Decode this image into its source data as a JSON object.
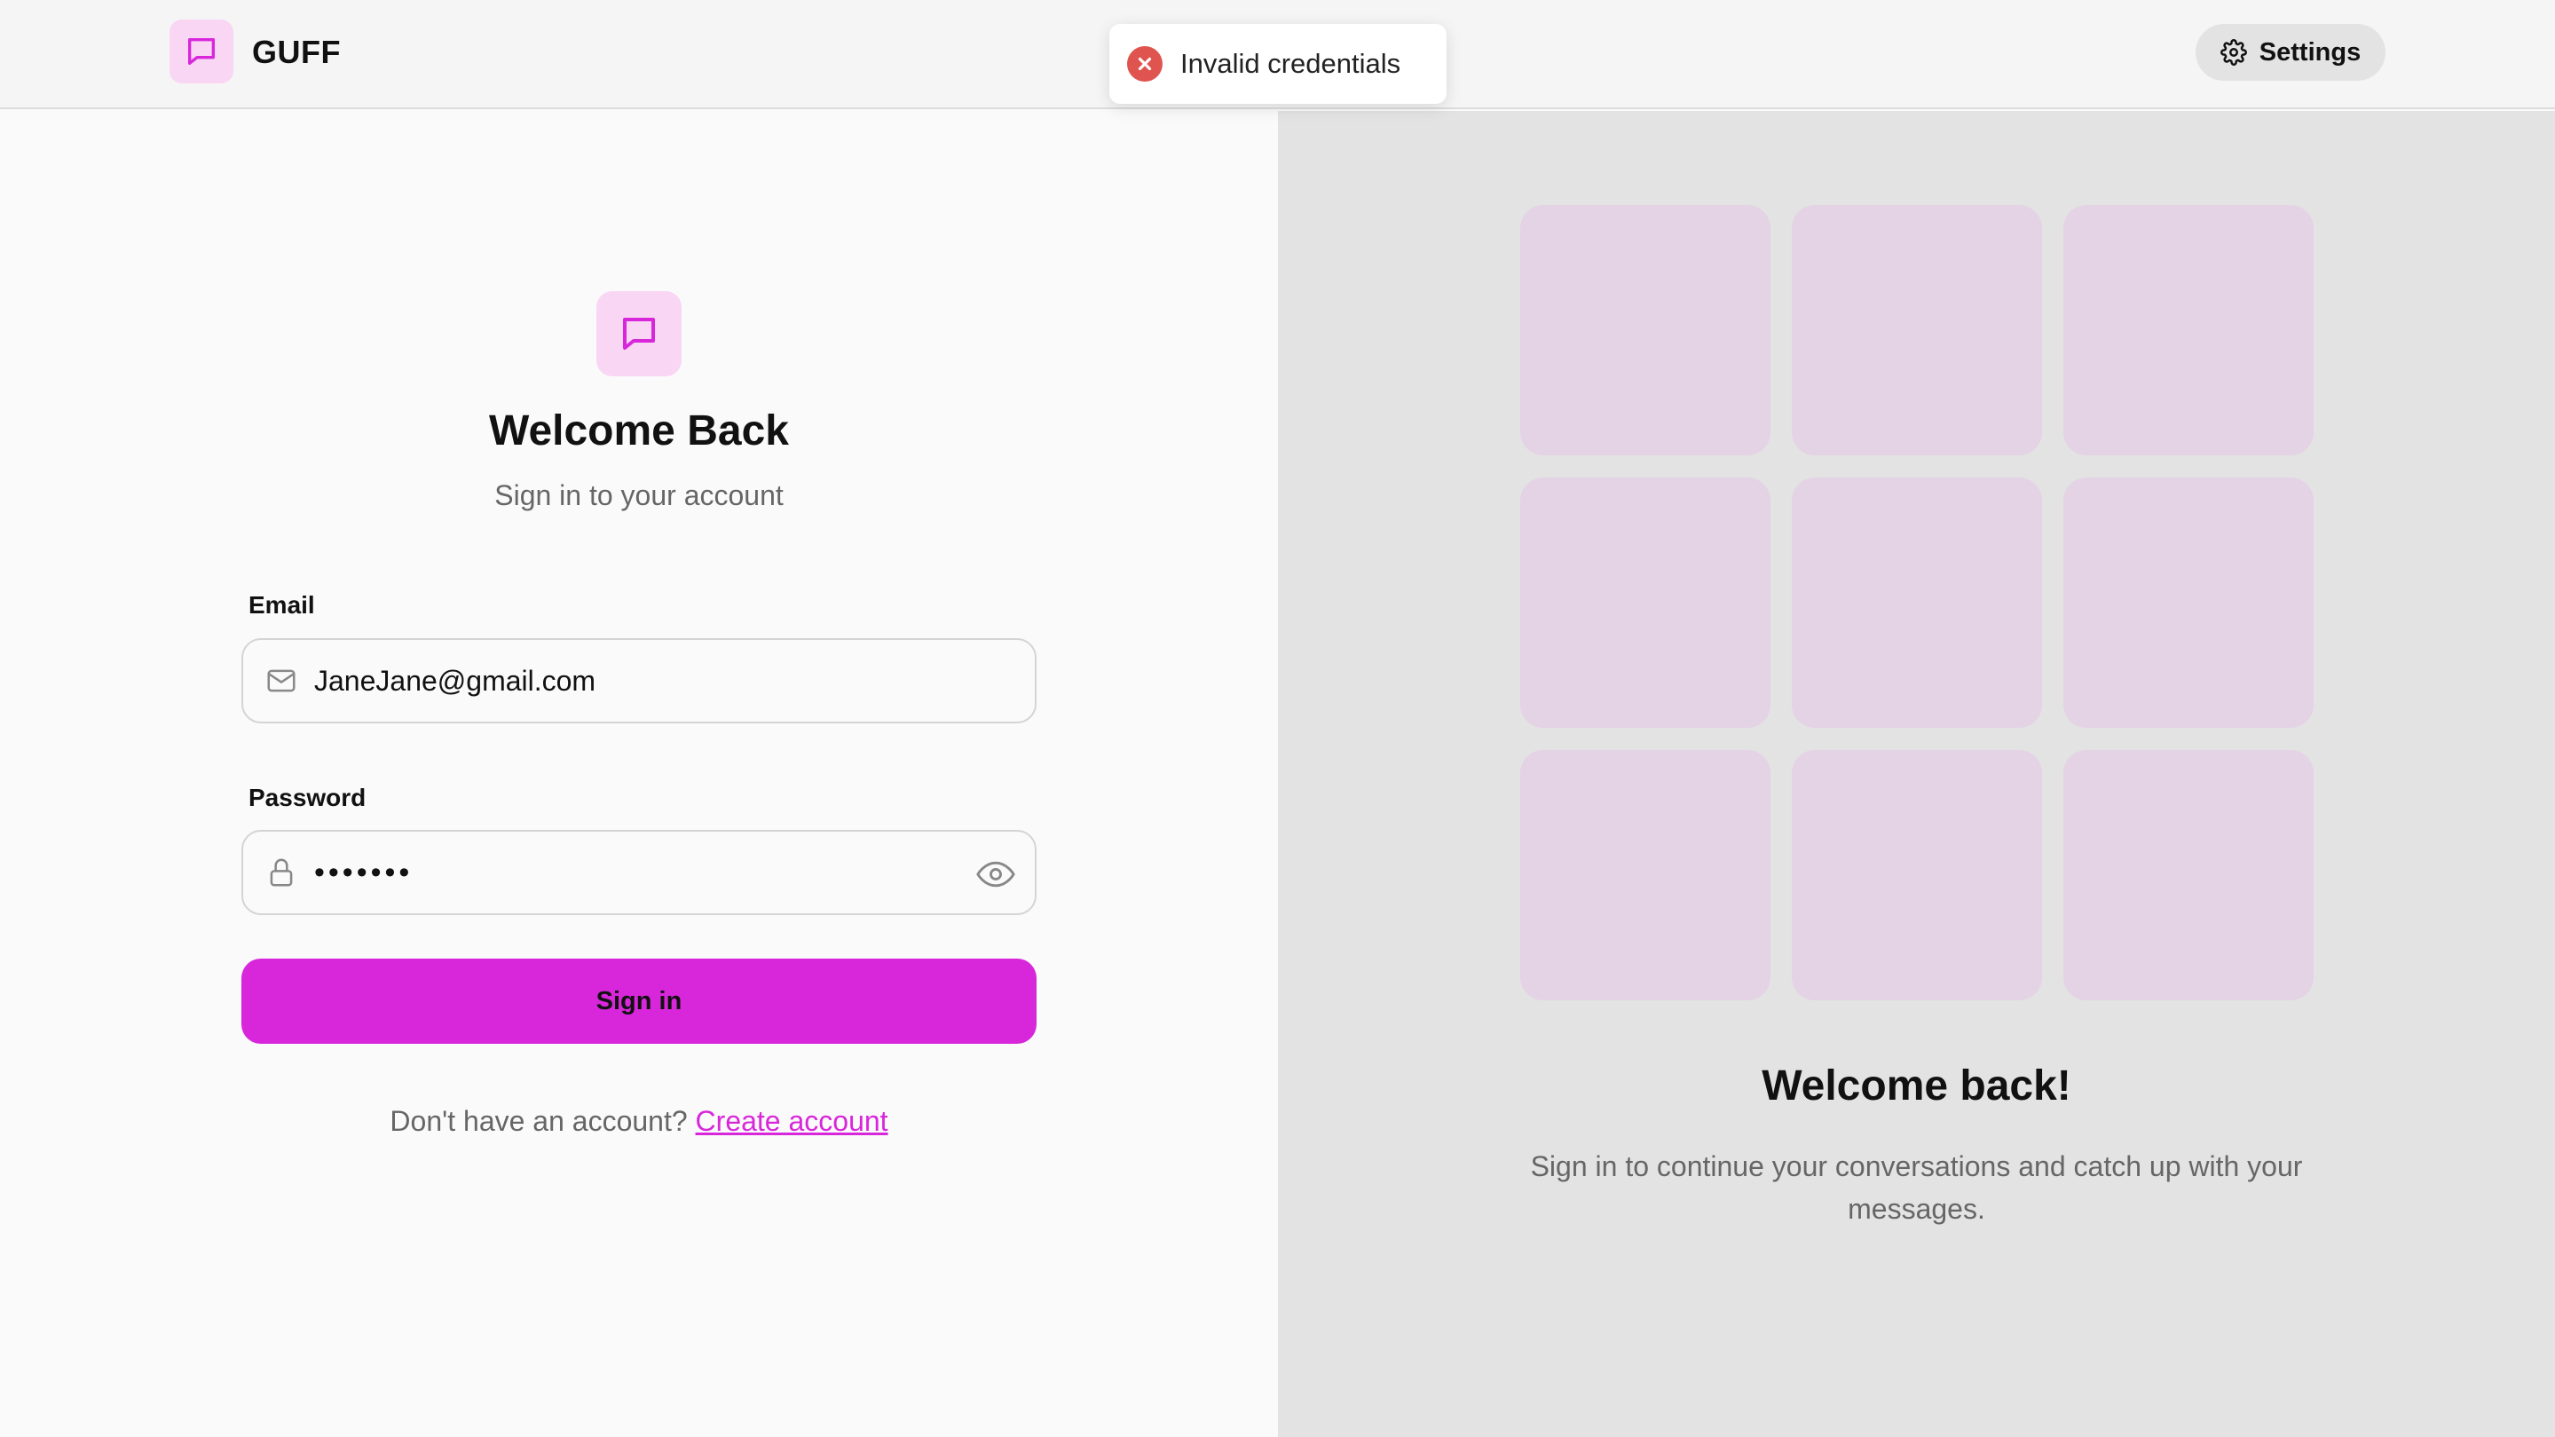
{
  "header": {
    "brand": "GUFF",
    "settings_label": "Settings"
  },
  "toast": {
    "message": "Invalid credentials",
    "type": "error"
  },
  "login": {
    "title": "Welcome Back",
    "subtitle": "Sign in to your account",
    "email_label": "Email",
    "email_value": "JaneJane@gmail.com",
    "password_label": "Password",
    "password_value": "•••••••",
    "signin_label": "Sign in",
    "signup_prompt": "Don't have an account?",
    "signup_link": "Create account"
  },
  "promo": {
    "title": "Welcome back!",
    "subtitle": "Sign in to continue your conversations and catch up with your messages."
  },
  "icons": {
    "logo": "chat-bubble-icon",
    "settings": "gear-icon",
    "toast": "x-circle-icon",
    "email": "mail-icon",
    "password": "lock-icon",
    "reveal": "eye-icon"
  },
  "colors": {
    "accent": "#d827db",
    "accent_light": "#f9d6f3",
    "tile": "#e4d2e5",
    "error": "#e0544f",
    "right_pane": "#e3e3e3"
  }
}
